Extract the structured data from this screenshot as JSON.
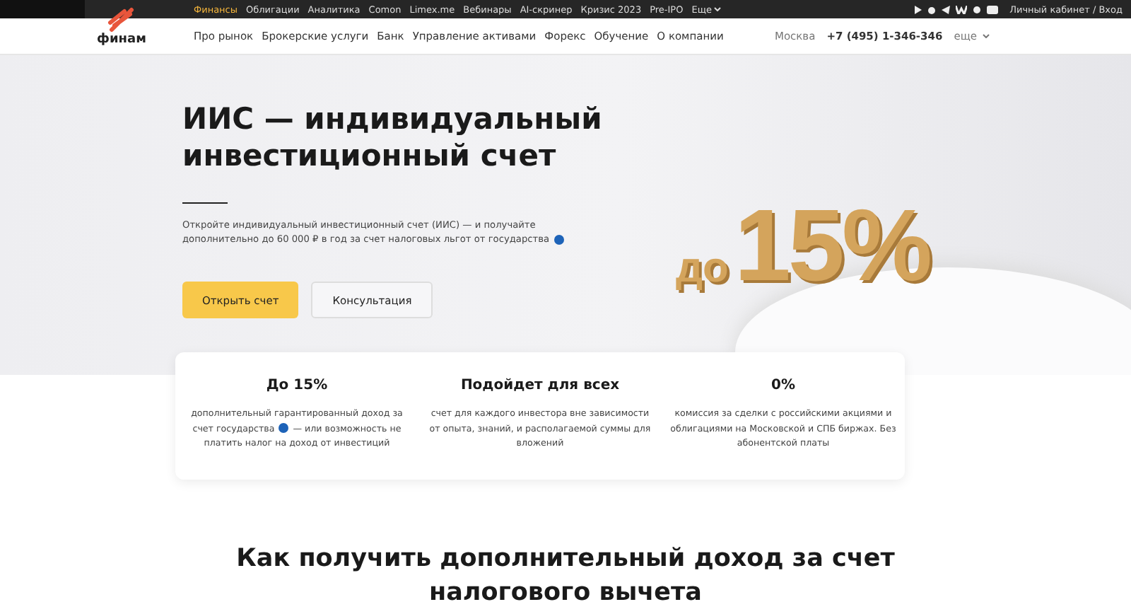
{
  "top_bar": {
    "links": [
      {
        "label": "Финансы",
        "selected": true
      },
      {
        "label": "Облигации",
        "selected": false
      },
      {
        "label": "Аналитика",
        "selected": false
      },
      {
        "label": "Comon",
        "selected": false
      },
      {
        "label": "Limex.me",
        "selected": false
      },
      {
        "label": "Вебинары",
        "selected": false
      },
      {
        "label": "AI-скринер",
        "selected": false
      },
      {
        "label": "Кризис 2023",
        "selected": false
      },
      {
        "label": "Pre-IPO",
        "selected": false
      }
    ],
    "more": "Еще",
    "account": "Личный кабинет / Вход"
  },
  "header": {
    "logo": "финам",
    "nav": [
      "Про рынок",
      "Брокерские услуги",
      "Банк",
      "Управление активами",
      "Форекс",
      "Обучение",
      "О компании"
    ],
    "city": "Москва",
    "phone": "+7 (495) 1-346-346",
    "more": "еще"
  },
  "hero": {
    "title": "ИИС — индивидуальный инвестиционный счет",
    "text": "Откройте индивидуальный инвестиционный счет (ИИС) — и получайте дополнительно до 60 000 ₽ в год за счет налоговых льгот от государства",
    "buttons": [
      {
        "label": "Открыть счет",
        "kind": "primary"
      },
      {
        "label": "Консультация",
        "kind": "secondary"
      }
    ],
    "promo": {
      "prefix": "до",
      "value": "15%"
    }
  },
  "features": [
    {
      "title": "До 15%",
      "text_before": "дополнительный гарантированный доход за счет государства",
      "text_after": "— или возможность не платить налог на доход от инвестиций"
    },
    {
      "title": "Подойдет для всех",
      "text_before": "счет для каждого инвестора вне зависимости от опыта, знаний, и располагаемой суммы для вложений"
    },
    {
      "title": "0%",
      "text_before": "комиссия за сделки с российскими акциями и облигациями на Московской и СПБ биржах. Без абонентской платы"
    }
  ],
  "section_title": "Как получить дополнительный доход за счет налогового вычета"
}
